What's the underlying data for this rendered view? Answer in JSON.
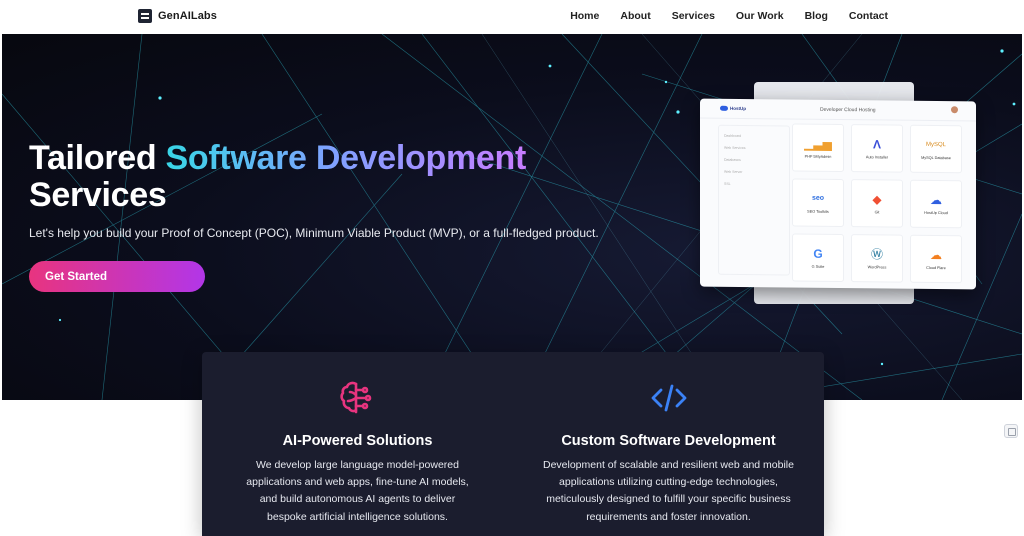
{
  "brand": {
    "name": "GenAILabs",
    "icon": "stack-logo-icon"
  },
  "nav": {
    "items": [
      "Home",
      "About",
      "Services",
      "Our Work",
      "Blog",
      "Contact"
    ]
  },
  "hero": {
    "title_prefix": "Tailored",
    "title_highlight": "Software Development",
    "title_suffix": "Services",
    "subtitle": "Let's help you build your Proof of Concept (POC), Minimum Viable Product (MVP), or a full-fledged product.",
    "cta_label": "Get Started"
  },
  "mockup": {
    "logo": "HostUp",
    "title": "Developer Cloud Hosting",
    "sidebar": [
      "Dashboard",
      "Web Services",
      "Databases",
      "Web Server",
      "SSL"
    ],
    "tiles": [
      {
        "label": "PHP 5MyAdmin",
        "icon": "bar-chart-icon"
      },
      {
        "label": "Auto Installer",
        "icon": "letter-a-icon"
      },
      {
        "label": "MySQL Database",
        "icon": "mysql-icon"
      },
      {
        "label": "SEO Toolkits",
        "icon": "seo-icon"
      },
      {
        "label": "Git",
        "icon": "git-icon"
      },
      {
        "label": "HostUp Cloud",
        "icon": "cloud-icon"
      },
      {
        "label": "G Suite",
        "icon": "google-icon"
      },
      {
        "label": "WordPress",
        "icon": "wordpress-icon"
      },
      {
        "label": "Cloud Flare",
        "icon": "cloudflare-icon"
      }
    ]
  },
  "features": [
    {
      "title": "AI-Powered Solutions",
      "text": "We develop large language model-powered applications and web apps, fine-tune AI models, and build autonomous AI agents to deliver bespoke artificial intelligence solutions.",
      "icon": "brain-icon"
    },
    {
      "title": "Custom Software Development",
      "text": "Development of scalable and resilient web and mobile applications utilizing cutting-edge technologies, meticulously designed to fulfill your specific business requirements and foster innovation.",
      "icon": "code-icon"
    }
  ],
  "colors": {
    "hero_bg": "#0b0d1c",
    "accent_gradient_start": "#38d6e6",
    "accent_gradient_end": "#c77dff",
    "cta_start": "#e8347f",
    "cta_end": "#b236e8",
    "card_bg": "#1b1d2e",
    "brain_icon": "#e8347f",
    "code_icon": "#3b82f6"
  }
}
